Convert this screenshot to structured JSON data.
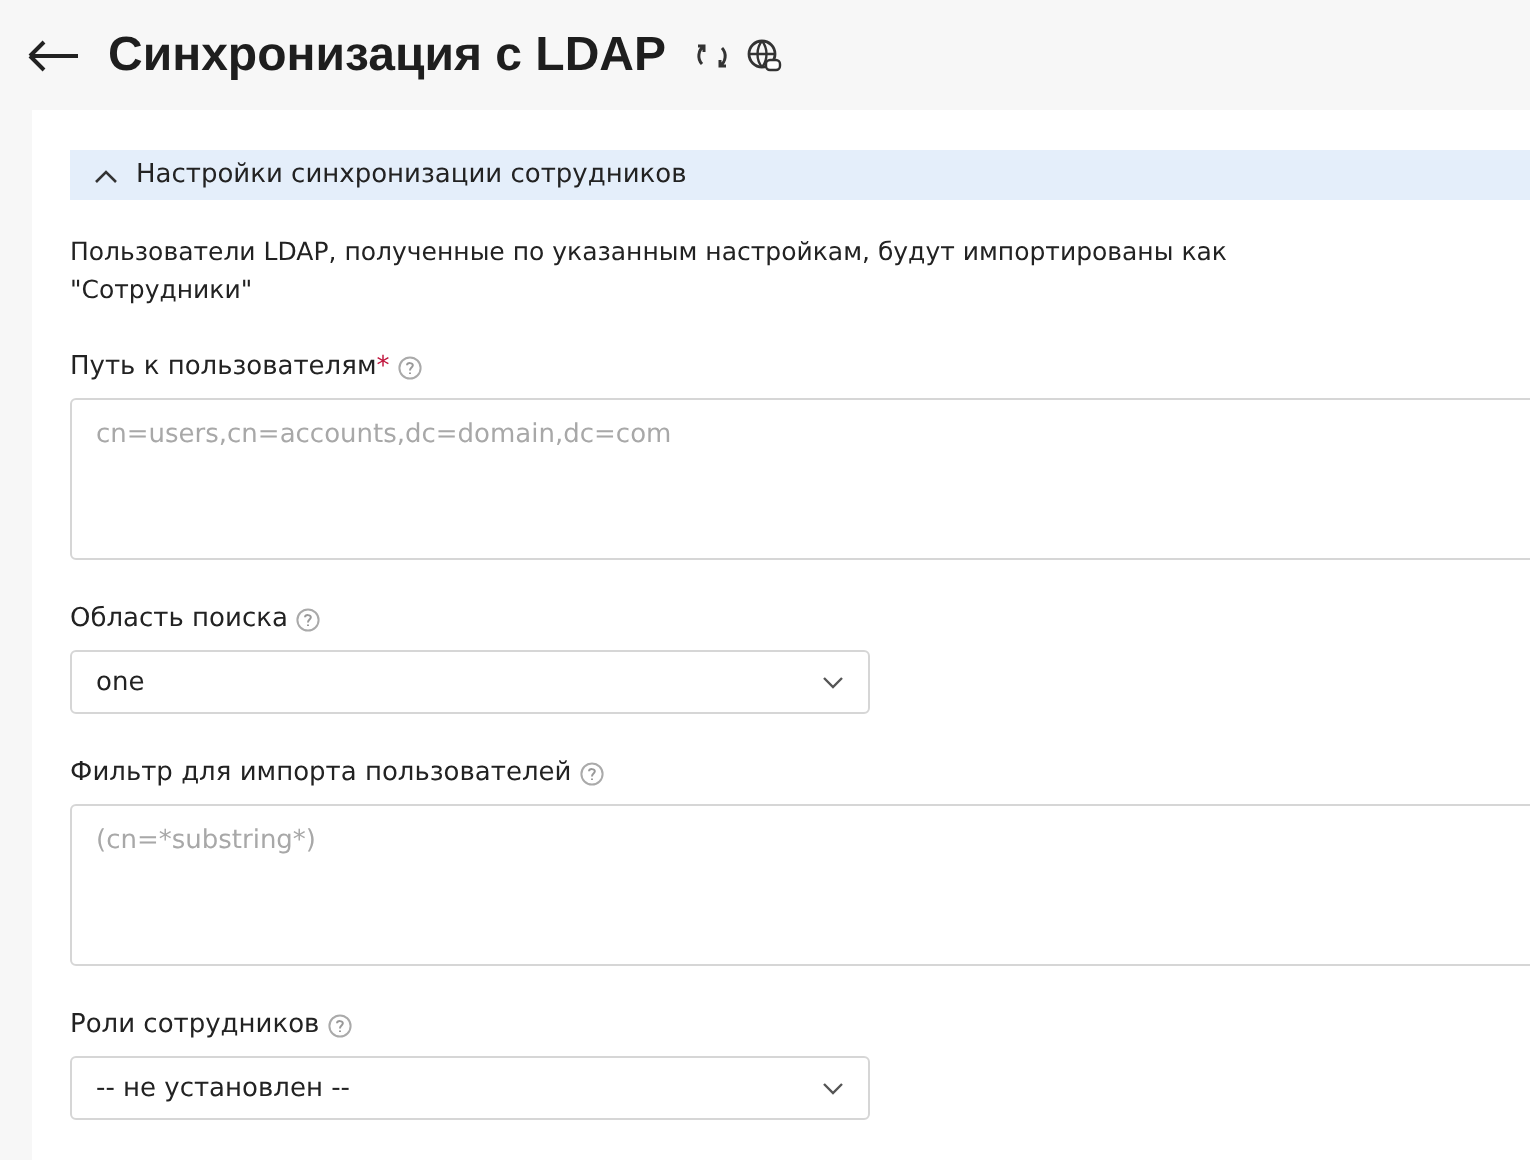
{
  "page": {
    "title": "Синхронизация с LDAP"
  },
  "section": {
    "title": "Настройки синхронизации сотрудников",
    "expanded": true,
    "description": "Пользователи LDAP, полученные по указанным настройкам, будут импортированы как \"Сотрудники\"",
    "fields": [
      {
        "kind": "textarea",
        "label": "Путь к пользователям",
        "required_mark": "*",
        "placeholder": "cn=users,cn=accounts,dc=domain,dc=com"
      },
      {
        "kind": "select",
        "label": "Область поиска",
        "value": "one"
      },
      {
        "kind": "textarea",
        "label": "Фильтр для импорта пользователей",
        "placeholder": "(cn=*substring*)"
      },
      {
        "kind": "select",
        "label": "Роли сотрудников",
        "value": "-- не установлен --"
      }
    ]
  }
}
